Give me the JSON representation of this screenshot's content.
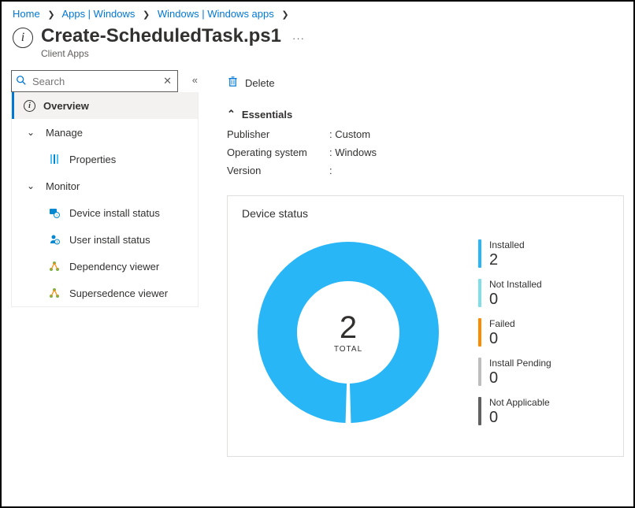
{
  "breadcrumb": [
    {
      "label": "Home"
    },
    {
      "label": "Apps | Windows"
    },
    {
      "label": "Windows | Windows apps"
    }
  ],
  "header": {
    "title": "Create-ScheduledTask.ps1",
    "subtitle": "Client Apps"
  },
  "sidebar": {
    "search_placeholder": "Search",
    "overview": "Overview",
    "manage": "Manage",
    "properties": "Properties",
    "monitor": "Monitor",
    "device_install_status": "Device install status",
    "user_install_status": "User install status",
    "dependency_viewer": "Dependency viewer",
    "supersedence_viewer": "Supersedence viewer"
  },
  "commands": {
    "delete": "Delete"
  },
  "essentials": {
    "header": "Essentials",
    "publisher_k": "Publisher",
    "publisher_v": "Custom",
    "os_k": "Operating system",
    "os_v": "Windows",
    "version_k": "Version",
    "version_v": ""
  },
  "device_status": {
    "title": "Device status",
    "total_label": "TOTAL",
    "total": "2",
    "legend": {
      "installed": {
        "label": "Installed",
        "value": "2",
        "color": "#29b6f6"
      },
      "not_installed": {
        "label": "Not Installed",
        "value": "0",
        "color": "#80deea"
      },
      "failed": {
        "label": "Failed",
        "value": "0",
        "color": "#fb8c00"
      },
      "install_pending": {
        "label": "Install Pending",
        "value": "0",
        "color": "#bdbdbd"
      },
      "not_applicable": {
        "label": "Not Applicable",
        "value": "0",
        "color": "#616161"
      }
    }
  },
  "chart_data": {
    "type": "pie",
    "title": "Device status",
    "total_label": "TOTAL",
    "total": 2,
    "series": [
      {
        "name": "Installed",
        "value": 2,
        "color": "#29b6f6"
      },
      {
        "name": "Not Installed",
        "value": 0,
        "color": "#80deea"
      },
      {
        "name": "Failed",
        "value": 0,
        "color": "#fb8c00"
      },
      {
        "name": "Install Pending",
        "value": 0,
        "color": "#bdbdbd"
      },
      {
        "name": "Not Applicable",
        "value": 0,
        "color": "#616161"
      }
    ]
  }
}
